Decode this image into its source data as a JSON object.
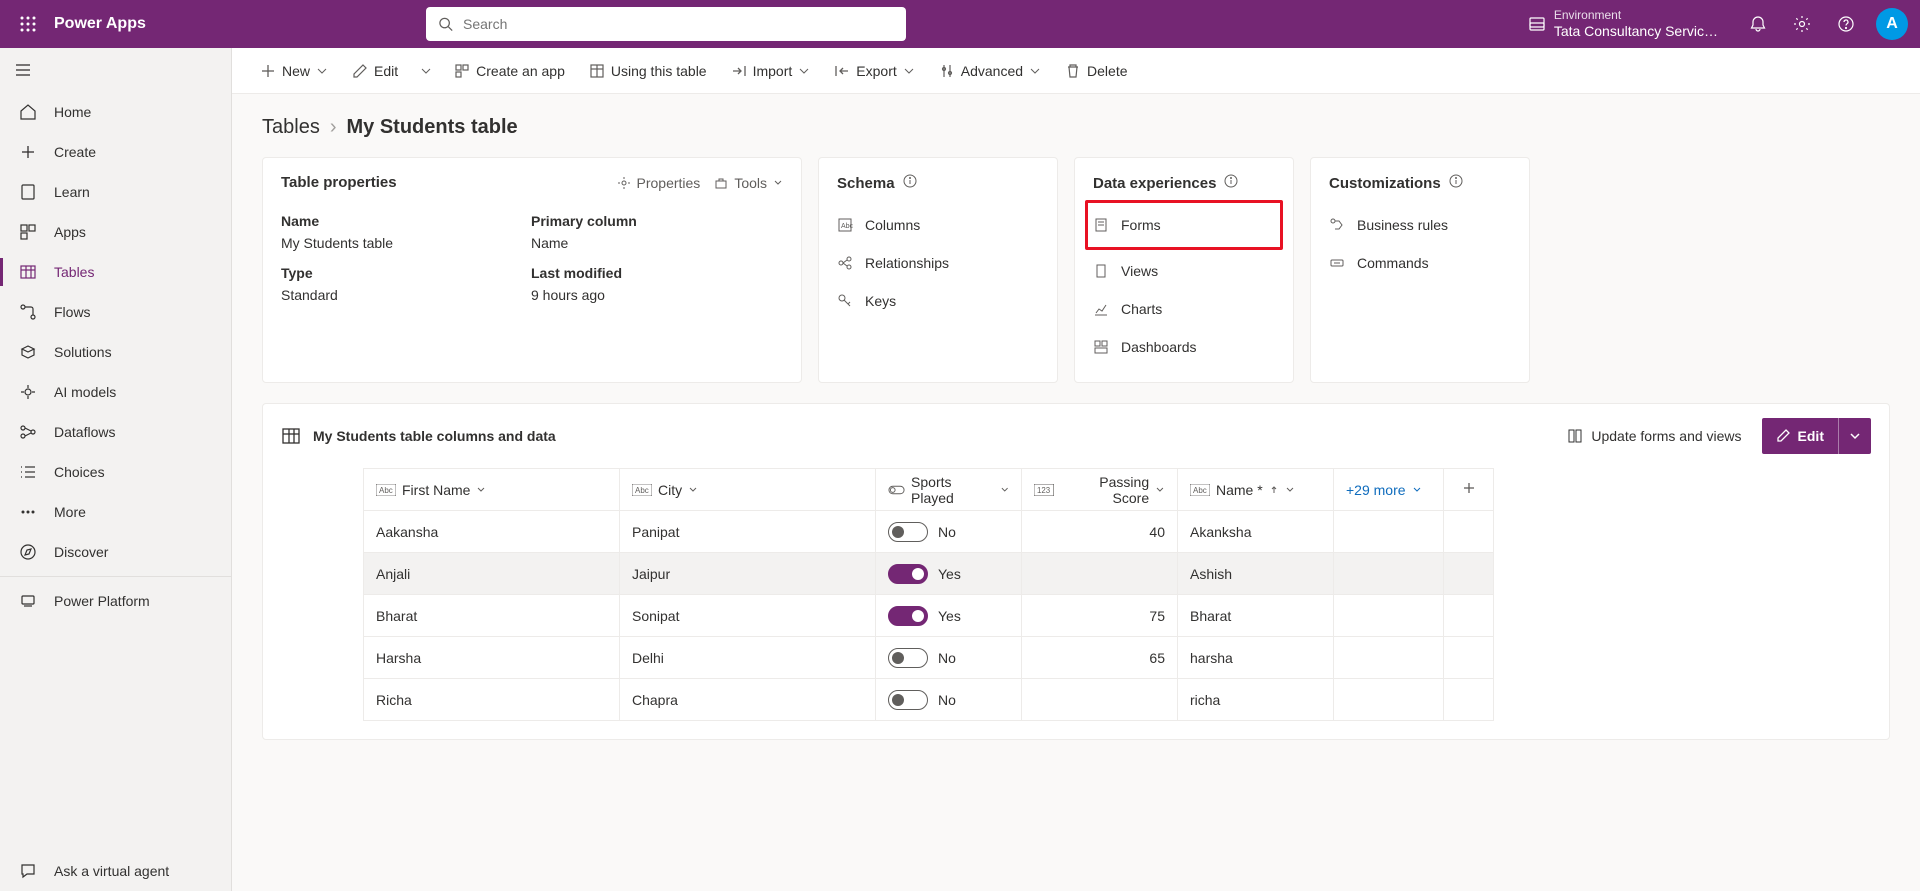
{
  "app_title": "Power Apps",
  "search_placeholder": "Search",
  "environment": {
    "label": "Environment",
    "name": "Tata Consultancy Servic…"
  },
  "avatar_initial": "A",
  "sidebar": {
    "items": [
      "Home",
      "Create",
      "Learn",
      "Apps",
      "Tables",
      "Flows",
      "Solutions",
      "AI models",
      "Dataflows",
      "Choices",
      "More",
      "Discover"
    ],
    "active_index": 4,
    "footer": "Power Platform",
    "ask": "Ask a virtual agent"
  },
  "commands": {
    "new": "New",
    "edit": "Edit",
    "create_app": "Create an app",
    "using_table": "Using this table",
    "import": "Import",
    "export": "Export",
    "advanced": "Advanced",
    "delete": "Delete"
  },
  "breadcrumb": {
    "root": "Tables",
    "current": "My Students table"
  },
  "properties_card": {
    "title": "Table properties",
    "properties_link": "Properties",
    "tools_link": "Tools",
    "labels": {
      "name": "Name",
      "primary": "Primary column",
      "type": "Type",
      "modified": "Last modified"
    },
    "values": {
      "name": "My Students table",
      "primary": "Name",
      "type": "Standard",
      "modified": "9 hours ago"
    }
  },
  "schema_card": {
    "title": "Schema",
    "items": [
      "Columns",
      "Relationships",
      "Keys"
    ]
  },
  "data_exp_card": {
    "title": "Data experiences",
    "items": [
      "Forms",
      "Views",
      "Charts",
      "Dashboards"
    ],
    "highlighted_index": 0
  },
  "custom_card": {
    "title": "Customizations",
    "items": [
      "Business rules",
      "Commands"
    ]
  },
  "data_section": {
    "title": "My Students table columns and data",
    "update_link": "Update forms and views",
    "edit_label": "Edit",
    "columns": {
      "first": "First Name",
      "city": "City",
      "sports": "Sports Played",
      "score": "Passing Score",
      "name": "Name *",
      "more": "+29 more"
    },
    "yes": "Yes",
    "no": "No",
    "rows": [
      {
        "first": "Aakansha",
        "city": "Panipat",
        "sports": false,
        "score": "40",
        "name": "Akanksha"
      },
      {
        "first": "Anjali",
        "city": "Jaipur",
        "sports": true,
        "score": "",
        "name": "Ashish",
        "selected": true
      },
      {
        "first": "Bharat",
        "city": "Sonipat",
        "sports": true,
        "score": "75",
        "name": "Bharat"
      },
      {
        "first": "Harsha",
        "city": "Delhi",
        "sports": false,
        "score": "65",
        "name": "harsha"
      },
      {
        "first": "Richa",
        "city": "Chapra",
        "sports": false,
        "score": "",
        "name": "richa"
      }
    ]
  }
}
